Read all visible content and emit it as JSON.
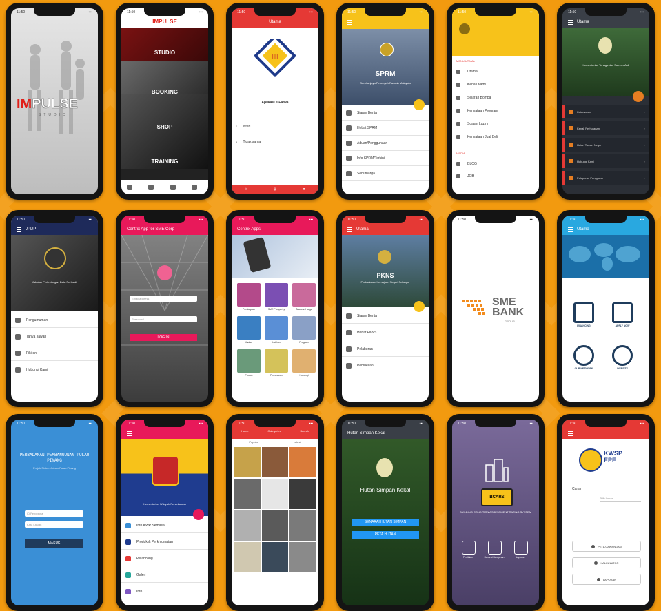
{
  "status_time": "11:50",
  "p1": {
    "logo_im": "IM",
    "logo_pulse": "PULSE",
    "logo_sub": "STUDIO"
  },
  "p2": {
    "brand": "IMPULSE",
    "items": [
      "STUDIO",
      "BOOKING",
      "SHOP",
      "TRAINING"
    ]
  },
  "p3": {
    "title": "Utama",
    "app_title": "Aplikasi e-Fatwa",
    "rows": [
      "Isteri",
      "Tidak sama"
    ]
  },
  "p4": {
    "banner": "SPRM",
    "banner_sub": "Suruhanjaya Pencegah Rasuah Malaysia",
    "rows": [
      "Siaran Berita",
      "Hebat SPRM",
      "Aduan/Penggunaan",
      "Info SPRM/Terkini",
      "Sebutharga"
    ]
  },
  "p5": {
    "section1": "MENU UTAMA",
    "section2": "MEDIA",
    "items": [
      "Utama",
      "Kenali Kami",
      "Sejarah Bomba",
      "Kenyataan Program",
      "Soalan Lazim",
      "Kenyataan Jual Beli"
    ],
    "items2": [
      "BLOG",
      "JOB"
    ]
  },
  "p6": {
    "title": "Utama",
    "banner_sub": "Kementerian Tenaga dan Sumber Asli",
    "menu": [
      "Ketamakan",
      "Kenali Perhutanan",
      "Hutan Taman Negeri",
      "Hubungi Kami",
      "Pelaporan Pengguna"
    ]
  },
  "p7": {
    "title": "JPDP",
    "banner_sub": "Jabatan Perlindungan Data Peribadi",
    "rows": [
      "Pengumuman",
      "Tanya Jawab",
      "Fikiran",
      "Hubungi Kami"
    ]
  },
  "p8": {
    "title": "Centrix App for SME Corp",
    "input1": "Email address",
    "input2": "Password",
    "button": "LOG IN"
  },
  "p9": {
    "title": "Centrix Apps",
    "captions": [
      "Perniagaan",
      "SME Prosperity",
      "Tawaran Harga",
      "Jualan",
      "Latihan",
      "Program",
      "Produk",
      "Pemasaran",
      "Hubungi"
    ]
  },
  "p10": {
    "title": "Utama",
    "banner": "PKNS",
    "banner_sub": "Perbadanan Kemajuan Negeri Selangor",
    "rows": [
      "Siaran Berita",
      "Hebat PKNS",
      "Pelaburan",
      "Pembelian"
    ]
  },
  "p11": {
    "sme": "SME",
    "bank": "BANK",
    "group": "GROUP"
  },
  "p12": {
    "title": "Utama",
    "labels": [
      "FINANCING",
      "APPLY NOW",
      "OUR NETWORK",
      "WEBSITE"
    ]
  },
  "p13": {
    "title": "PERBADANAN PEMBANGUNAN PULAU PINANG",
    "sub": "Projek Sistem Aduan Pulau Pinang",
    "input1": "ID Pengguna",
    "input2": "Kata Laluan",
    "button": "MASUK"
  },
  "p14": {
    "banner_sub": "Kementerian Wilayah Persekutuan",
    "rows": [
      "Info KWP Semasa",
      "Produk & Perkhidmatan",
      "Pelancong",
      "Galeri",
      "Info"
    ]
  },
  "p15": {
    "tabs": [
      "Home",
      "Categories",
      "Search"
    ],
    "filters": [
      "Popular",
      "Latest"
    ]
  },
  "p16": {
    "title": "Hutan Simpan Kekal",
    "banner": "Hutan Simpan Kekal",
    "btn1": "SENARAI HUTAN SIMPAN",
    "btn2": "PETA HUTAN"
  },
  "p17": {
    "title": "BUILDING CONDITION ASSESSMENT RATING SYSTEM",
    "logo": "BCARS",
    "labels": [
      "Penilaian",
      "Senarai Bangunan",
      "Laporan"
    ]
  },
  "p18": {
    "brand1": "KWSP",
    "brand2": "EPF",
    "label": "Carian",
    "select": "Pilih Lokasi",
    "buttons": [
      "PETA CAWANGAN",
      "KALKULATOR",
      "LAPORAN"
    ]
  },
  "colors": {
    "bg": "#f29a0f",
    "red": "#e53935",
    "pink": "#e8195a",
    "blue": "#2196f3",
    "yellow": "#f7c21a",
    "navy": "#1e2a5a"
  }
}
